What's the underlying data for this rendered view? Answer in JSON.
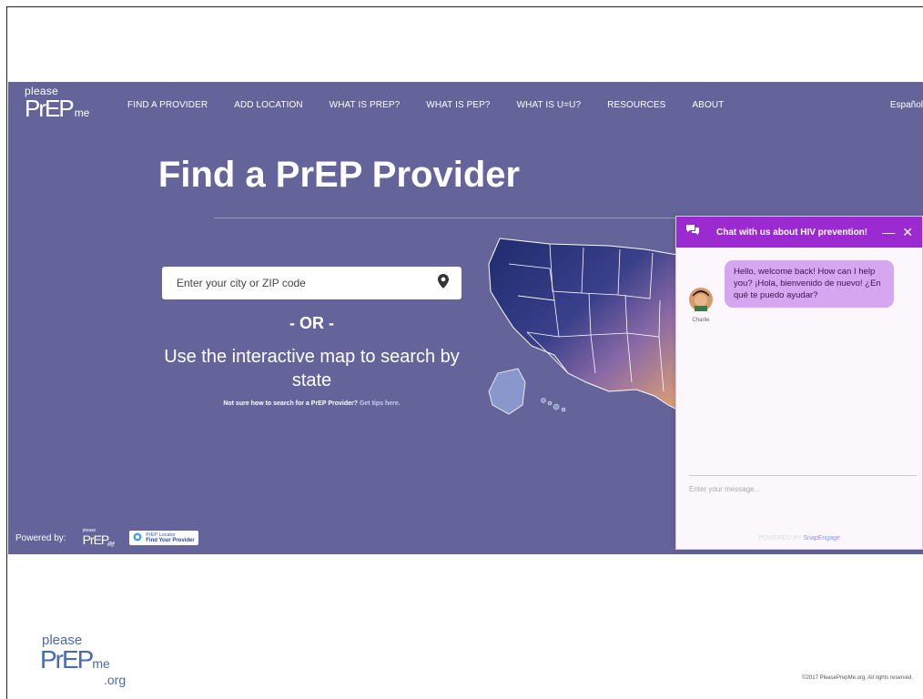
{
  "nav": {
    "logo": {
      "please": "please",
      "prep": "PrEP",
      "me": "me"
    },
    "items": [
      {
        "label": "FIND A PROVIDER"
      },
      {
        "label": "ADD LOCATION"
      },
      {
        "label": "WHAT IS PREP?"
      },
      {
        "label": "WHAT IS PEP?"
      },
      {
        "label": "WHAT IS U=U?"
      },
      {
        "label": "RESOURCES"
      },
      {
        "label": "ABOUT"
      }
    ],
    "language": "Español"
  },
  "hero": {
    "title": "Find a PrEP Provider",
    "search_placeholder": "Enter your city or ZIP code",
    "or": "- OR -",
    "map_text": "Use the interactive map to search by state",
    "tips_prefix": "Not sure how to search for a PrEP Provider?",
    "tips_link": "Get tips here."
  },
  "powered": {
    "label": "Powered by:",
    "mini_logo": {
      "please": "please",
      "prep": "PrEP",
      "me": "me",
      "org": "org"
    },
    "locator_top": "PrEP Locator",
    "locator_bottom": "Find Your Provider"
  },
  "chat": {
    "header": "Chat with us about HIV prevention!",
    "agent_name": "Charlie",
    "message": "Hello, welcome back! How can I help you? ¡Hola, bienvenido de nuevo! ¿En qué te puedo ayudar?",
    "input_placeholder": "Enter your message...",
    "footer_prefix": "POWERED BY",
    "footer_brand": "SnapEngage"
  },
  "footer": {
    "logo": {
      "please": "please",
      "prep": "PrEP",
      "me": "me",
      "org": ".org"
    },
    "copyright": "©2017 PleasePrepMe.org. All rights reserved."
  },
  "colors": {
    "hero_bg": "#64639a",
    "chat_accent": "#9b2bd0",
    "bubble": "#d7a6f0"
  }
}
